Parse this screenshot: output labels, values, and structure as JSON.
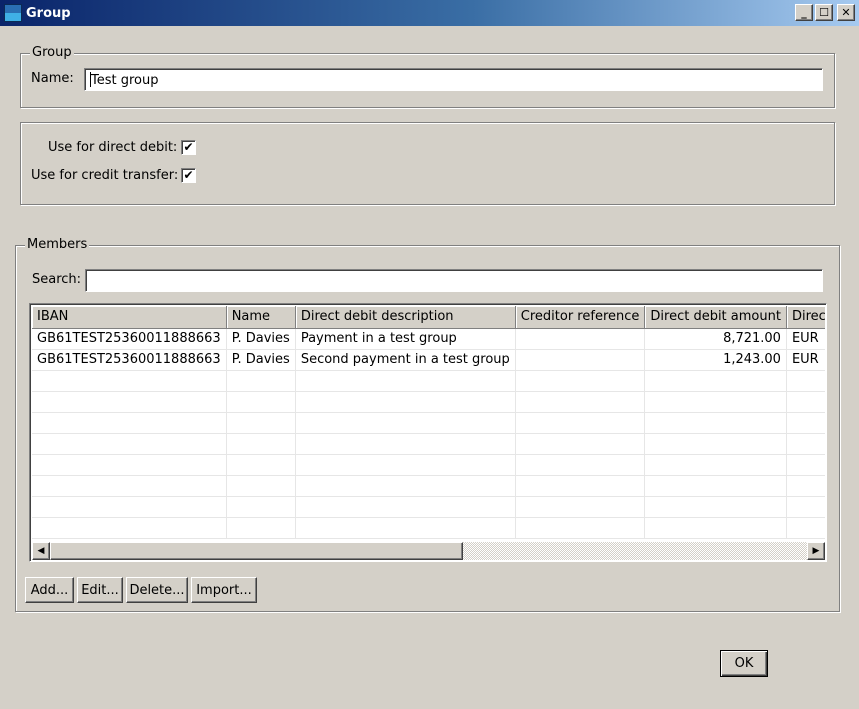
{
  "window": {
    "title": "Group",
    "controls": {
      "minimize": "_",
      "maximize": "☐",
      "close": "✕"
    }
  },
  "group_box": {
    "legend": "Group",
    "name_label": "Name:",
    "name_value": "Test group"
  },
  "options": {
    "direct_debit_label": "Use for direct debit:",
    "direct_debit_checked": true,
    "credit_transfer_label": "Use for credit transfer:",
    "credit_transfer_checked": true,
    "check_mark": "✔"
  },
  "members": {
    "legend": "Members",
    "search_label": "Search:",
    "search_value": "",
    "columns": [
      "IBAN",
      "Name",
      "Direct debit description",
      "Creditor reference",
      "Direct debit amount",
      "Direct debit"
    ],
    "rows": [
      [
        "GB61TEST25360011888663",
        "P. Davies",
        "Payment in a test group",
        "",
        "8,721.00",
        "EUR"
      ],
      [
        "GB61TEST25360011888663",
        "P. Davies",
        "Second payment in a test group",
        "",
        "1,243.00",
        "EUR"
      ]
    ],
    "empty_rows": 8,
    "buttons": {
      "add": "Add...",
      "edit": "Edit...",
      "delete": "Delete...",
      "import": "Import..."
    }
  },
  "scrollbar": {
    "left_arrow": "◀",
    "right_arrow": "▶"
  },
  "footer": {
    "ok": "OK"
  }
}
